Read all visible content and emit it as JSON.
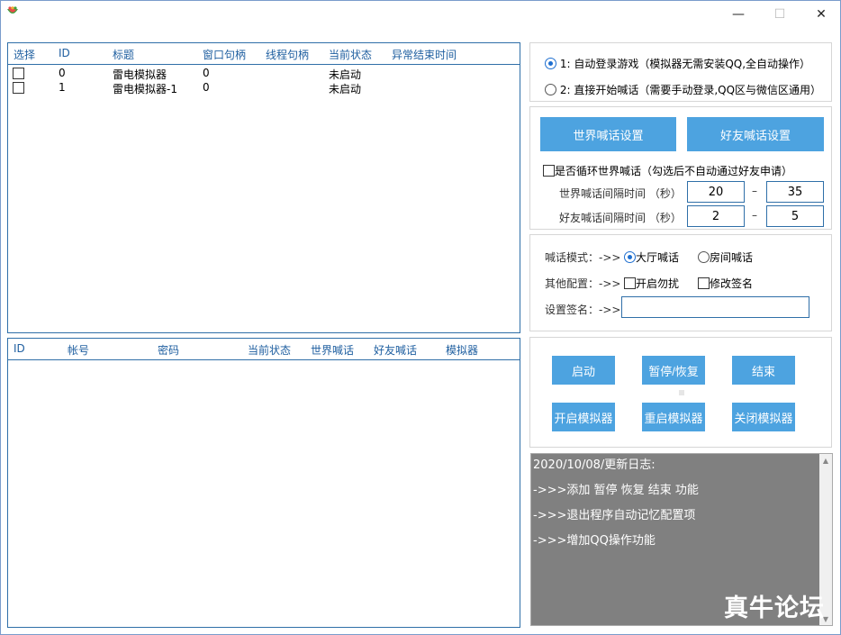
{
  "window": {
    "icon": "watermelon-app-icon",
    "controls": {
      "minimize": "—",
      "maximize": "☐",
      "close": "✕"
    }
  },
  "emulator_list": {
    "headers": [
      "选择",
      "ID",
      "标题",
      "窗口句柄",
      "线程句柄",
      "当前状态",
      "异常结束时间"
    ],
    "rows": [
      {
        "checked": false,
        "id": "0",
        "title": "雷电模拟器",
        "window_handle": "0",
        "thread_handle": "",
        "status": "未启动",
        "end_time": ""
      },
      {
        "checked": false,
        "id": "1",
        "title": "雷电模拟器-1",
        "window_handle": "0",
        "thread_handle": "",
        "status": "未启动",
        "end_time": ""
      }
    ]
  },
  "account_list": {
    "headers": [
      "ID",
      "帐号",
      "密码",
      "当前状态",
      "世界喊话",
      "好友喊话",
      "模拟器"
    ]
  },
  "mode": {
    "option1": "1: 自动登录游戏（模拟器无需安装QQ,全自动操作）",
    "option2": "2: 直接开始喊话（需要手动登录,QQ区与微信区通用）",
    "selected": 1
  },
  "shout_settings": {
    "world_button": "世界喊话设置",
    "friend_button": "好友喊话设置",
    "loop_label": "是否循环世界喊话（勾选后不自动通过好友申请）",
    "world_interval_label": "世界喊话间隔时间 （秒）",
    "world_min": "20",
    "world_max": "35",
    "friend_interval_label": "好友喊话间隔时间 （秒）",
    "friend_min": "2",
    "friend_max": "5",
    "dash": "–"
  },
  "config": {
    "mode_label": "喊话模式：->>",
    "mode_hall": "大厅喊话",
    "mode_room": "房间喊话",
    "other_label": "其他配置：->>",
    "dnd": "开启勿扰",
    "modify_sig": "修改签名",
    "sig_label": "设置签名：->>",
    "sig_value": ""
  },
  "controls": {
    "start": "启动",
    "pause_resume": "暂停/恢复",
    "end": "结束",
    "open_emu": "开启模拟器",
    "restart_emu": "重启模拟器",
    "close_emu": "关闭模拟器"
  },
  "log": {
    "lines": [
      "2020/10/08/更新日志:",
      "->>>添加 暂停 恢复 结束 功能",
      "->>>退出程序自动记忆配置项",
      "->>>增加QQ操作功能"
    ],
    "scroll_up": "▲",
    "scroll_down": "▼"
  },
  "watermark": "真牛论坛"
}
